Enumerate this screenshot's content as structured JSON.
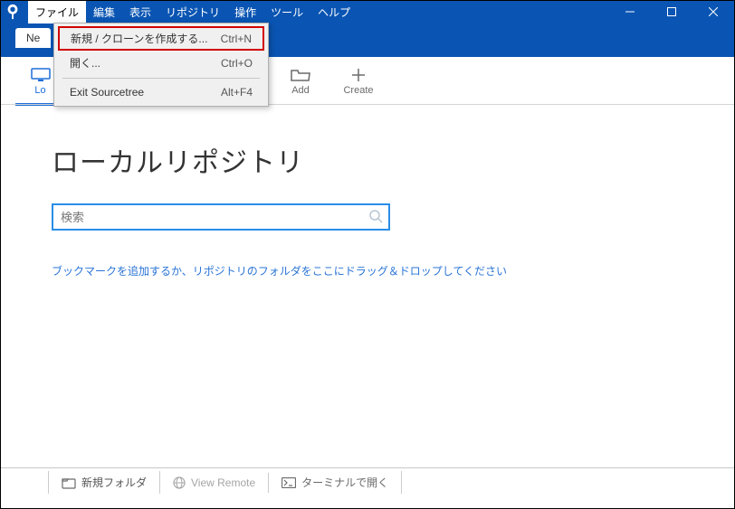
{
  "menubar": {
    "items": [
      "ファイル",
      "編集",
      "表示",
      "リポジトリ",
      "操作",
      "ツール",
      "ヘルプ"
    ],
    "active_index": 0
  },
  "tab": {
    "new_label_visible": "Ne"
  },
  "dropdown": {
    "items": [
      {
        "label": "新規 / クローンを作成する...",
        "shortcut": "Ctrl+N",
        "highlighted": true
      },
      {
        "label": "開く...",
        "shortcut": "Ctrl+O"
      }
    ],
    "exit": {
      "label": "Exit Sourcetree",
      "shortcut": "Alt+F4"
    }
  },
  "toolbar": {
    "local_label_visible": "Lo",
    "add_label": "Add",
    "create_label": "Create"
  },
  "main": {
    "title": "ローカルリポジトリ",
    "search_placeholder": "検索",
    "hint": "ブックマークを追加するか、リポジトリのフォルダをここにドラッグ＆ドロップしてください"
  },
  "statusbar": {
    "new_folder": "新規フォルダ",
    "view_remote": "View Remote",
    "terminal": "ターミナルで開く"
  },
  "colors": {
    "brand_blue": "#0a55b3",
    "link_blue": "#2a74d6",
    "icon_gray": "#6a6a6a"
  }
}
